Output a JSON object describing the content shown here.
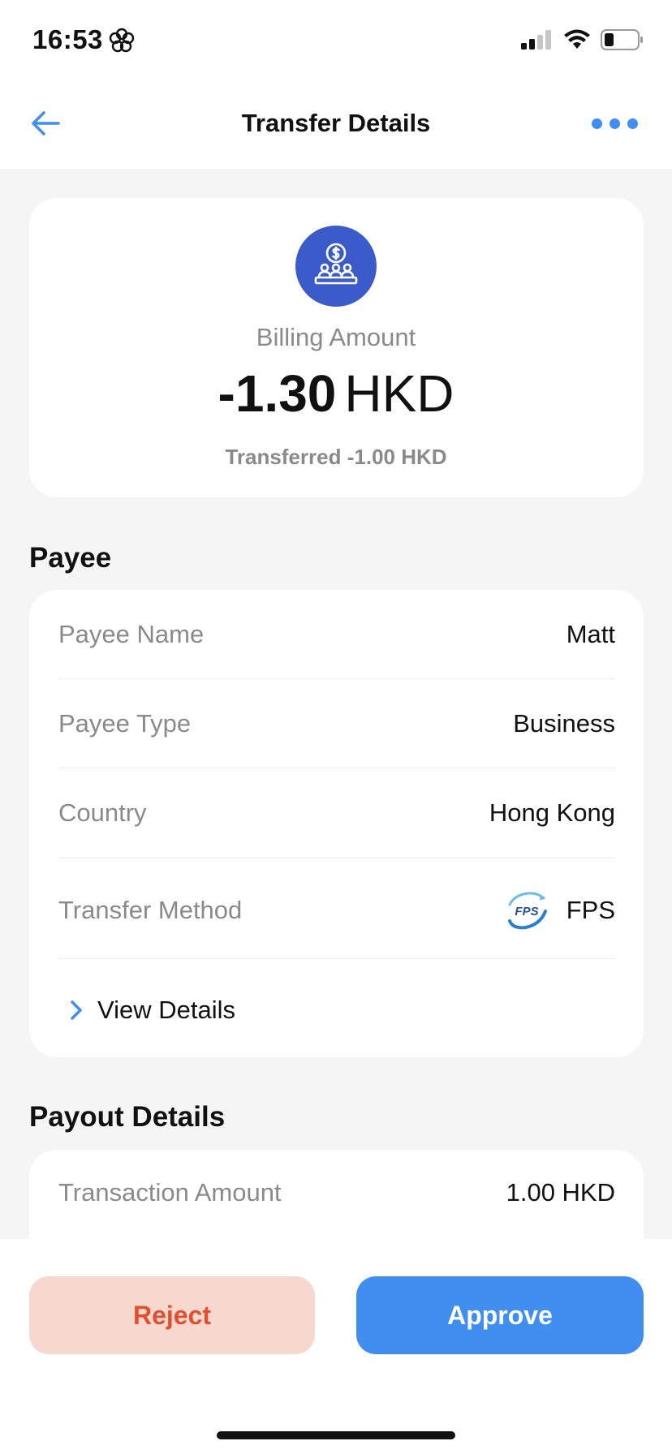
{
  "status_bar": {
    "time": "16:53"
  },
  "nav": {
    "title": "Transfer Details"
  },
  "amount_card": {
    "label": "Billing Amount",
    "amount": "-1.30",
    "currency": "HKD",
    "subtext": "Transferred -1.00 HKD"
  },
  "payee": {
    "section_title": "Payee",
    "rows": [
      {
        "label": "Payee Name",
        "value": "Matt"
      },
      {
        "label": "Payee Type",
        "value": "Business"
      },
      {
        "label": "Country",
        "value": "Hong Kong"
      },
      {
        "label": "Transfer Method",
        "value": "FPS",
        "logo_text": "FPS"
      }
    ],
    "view_details": "View Details"
  },
  "payout": {
    "section_title": "Payout Details",
    "rows": [
      {
        "label": "Transaction Amount",
        "value": "1.00 HKD"
      }
    ]
  },
  "actions": {
    "reject": "Reject",
    "approve": "Approve"
  },
  "colors": {
    "accent": "#3f8ef0",
    "icon_bg": "#3b5bcb",
    "reject_bg": "#f6d8cf",
    "reject_text": "#e0502f"
  }
}
